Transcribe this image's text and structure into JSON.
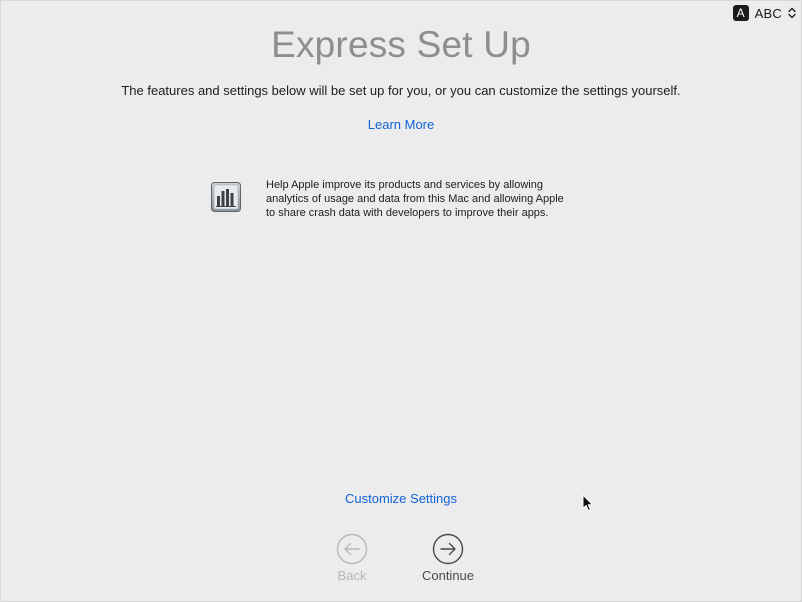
{
  "input_menu": {
    "badge": "A",
    "label": "ABC"
  },
  "title": "Express Set Up",
  "subtitle": "The features and settings below will be set up for you, or you can customize the settings yourself.",
  "learn_more": "Learn More",
  "feature": {
    "icon": "analytics-bar-chart-icon",
    "line1": "Help Apple improve its products and services by allowing",
    "line2": "analytics of usage and data from this Mac and allowing Apple",
    "line3": "to share crash data with developers to improve their apps."
  },
  "customize_settings": "Customize Settings",
  "nav": {
    "back_label": "Back",
    "continue_label": "Continue"
  },
  "colors": {
    "background": "#ececec",
    "link": "#1163d6",
    "title": "#8e8e8e",
    "disabled": "#b8b8b8"
  }
}
